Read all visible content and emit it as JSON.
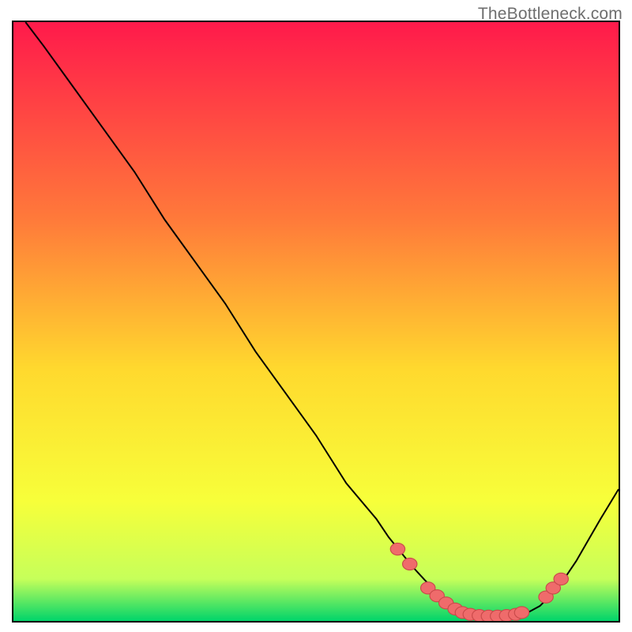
{
  "watermark": "TheBottleneck.com",
  "colors": {
    "grad_top": "#ff1a4b",
    "grad_mid1": "#ff7a3a",
    "grad_mid2": "#ffd92e",
    "grad_mid3": "#f7ff3a",
    "grad_mid4": "#c6ff5a",
    "grad_bottom": "#00d46a",
    "curve": "#000000",
    "dot_fill": "#ef6b6b",
    "dot_stroke": "#c94a4a",
    "frame": "#000000"
  },
  "chart_data": {
    "type": "line",
    "title": "",
    "xlabel": "",
    "ylabel": "",
    "xlim": [
      0,
      100
    ],
    "ylim": [
      0,
      100
    ],
    "x": [
      2,
      5,
      10,
      15,
      20,
      25,
      30,
      35,
      40,
      45,
      50,
      55,
      60,
      62,
      64,
      66,
      68,
      70,
      72,
      74,
      76,
      78,
      80,
      82,
      84,
      85,
      87,
      89,
      91,
      93,
      95,
      97,
      100
    ],
    "y": [
      100,
      96,
      89,
      82,
      75,
      67,
      60,
      53,
      45,
      38,
      31,
      23,
      17,
      14,
      11.5,
      9,
      6.8,
      4.8,
      3.3,
      2.2,
      1.4,
      1.0,
      0.8,
      0.8,
      1.0,
      1.4,
      2.5,
      4.5,
      7,
      10,
      13.5,
      17,
      22
    ],
    "marker_points": [
      {
        "x": 63.5,
        "y": 12
      },
      {
        "x": 65.5,
        "y": 9.5
      },
      {
        "x": 68.5,
        "y": 5.5
      },
      {
        "x": 70,
        "y": 4.2
      },
      {
        "x": 71.5,
        "y": 3.0
      },
      {
        "x": 73,
        "y": 2.0
      },
      {
        "x": 74.2,
        "y": 1.4
      },
      {
        "x": 75.5,
        "y": 1.1
      },
      {
        "x": 77,
        "y": 0.9
      },
      {
        "x": 78.5,
        "y": 0.8
      },
      {
        "x": 80,
        "y": 0.8
      },
      {
        "x": 81.5,
        "y": 0.9
      },
      {
        "x": 83,
        "y": 1.1
      },
      {
        "x": 84,
        "y": 1.4
      },
      {
        "x": 88,
        "y": 4.0
      },
      {
        "x": 89.2,
        "y": 5.5
      },
      {
        "x": 90.5,
        "y": 7.0
      }
    ]
  }
}
